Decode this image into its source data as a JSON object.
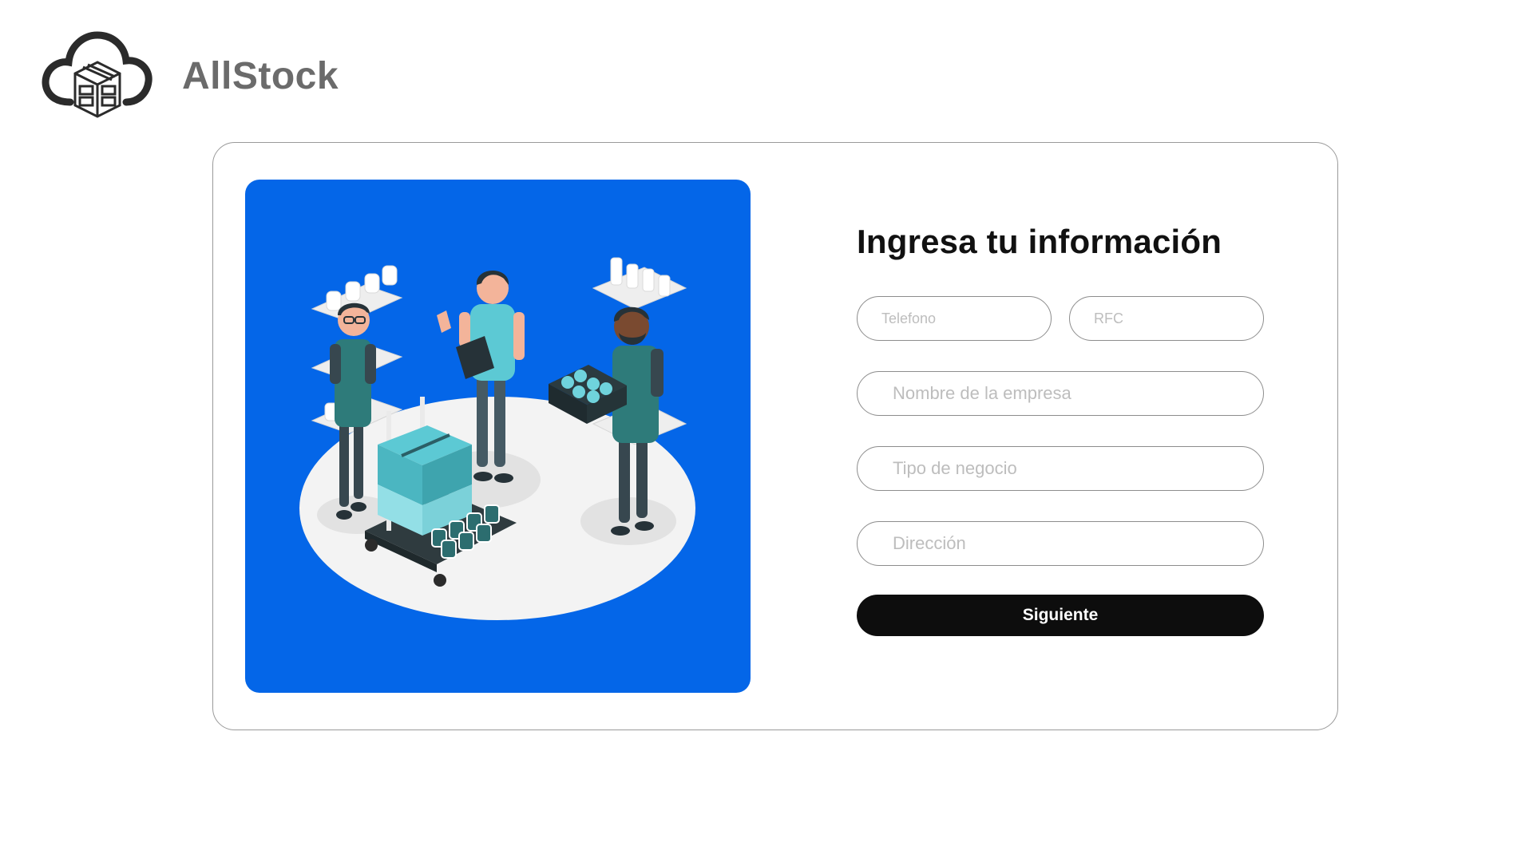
{
  "app": {
    "brand_name": "AllStock",
    "logo_icon": "cloud-warehouse-icon"
  },
  "form": {
    "title": "Ingresa tu información",
    "fields": {
      "telefono": {
        "placeholder": "Telefono",
        "value": ""
      },
      "rfc": {
        "placeholder": "RFC",
        "value": ""
      },
      "nombre_empresa": {
        "placeholder": "Nombre de la empresa",
        "value": ""
      },
      "tipo_negocio": {
        "placeholder": "Tipo de negocio",
        "value": ""
      },
      "direccion": {
        "placeholder": "Dirección",
        "value": ""
      }
    },
    "submit_label": "Siguiente"
  },
  "illustration": {
    "icon": "warehouse-workers-illustration"
  },
  "colors": {
    "illustration_bg": "#0466e8",
    "button_bg": "#0d0d0d",
    "accent_teal": "#4fc4cf",
    "brand_gray": "#6b6b6b"
  }
}
